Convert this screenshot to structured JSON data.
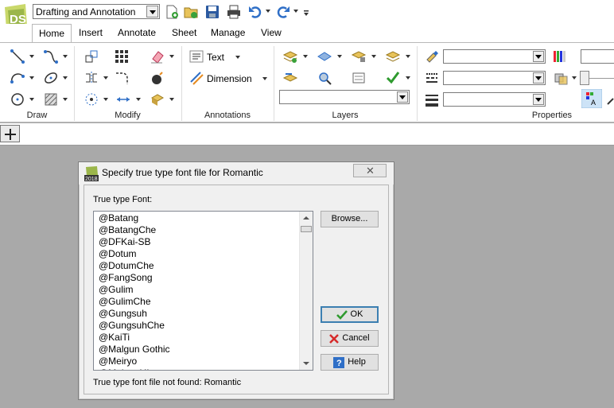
{
  "app": {
    "logo_text": "DS"
  },
  "qat": {
    "workspace_value": "Drafting and Annotation",
    "buttons": [
      "new-icon",
      "open-icon",
      "save-icon",
      "print-icon",
      "undo-icon",
      "redo-icon"
    ]
  },
  "tabs": [
    "Home",
    "Insert",
    "Annotate",
    "Sheet",
    "Manage",
    "View"
  ],
  "active_tab": "Home",
  "ribbon": {
    "panels": {
      "draw": "Draw",
      "modify": "Modify",
      "annotations": "Annotations",
      "layers": "Layers",
      "properties": "Properties"
    },
    "text_label": "Text",
    "dimension_label": "Dimension",
    "layer_value": "",
    "color_value": "",
    "linetype_value": "",
    "lineweight_value": ""
  },
  "dialog": {
    "icon_year": "2018",
    "title": "Specify true type font file for Romantic",
    "label": "True type Font:",
    "fonts": [
      "@Batang",
      "@BatangChe",
      "@DFKai-SB",
      "@Dotum",
      "@DotumChe",
      "@FangSong",
      "@Gulim",
      "@GulimChe",
      "@Gungsuh",
      "@GungsuhChe",
      "@KaiTi",
      "@Malgun Gothic",
      "@Meiryo",
      "@Meiryo UI"
    ],
    "browse_label": "Browse...",
    "ok_label": "OK",
    "cancel_label": "Cancel",
    "help_label": "Help",
    "status": "True type font file not found: Romantic"
  },
  "colors": {
    "workspace_bg": "#a9a9a9",
    "accent": "#3c7fb1",
    "ok_check": "#2e9a2e",
    "cancel_x": "#d62a2a",
    "help_blue": "#2f6fc7"
  }
}
